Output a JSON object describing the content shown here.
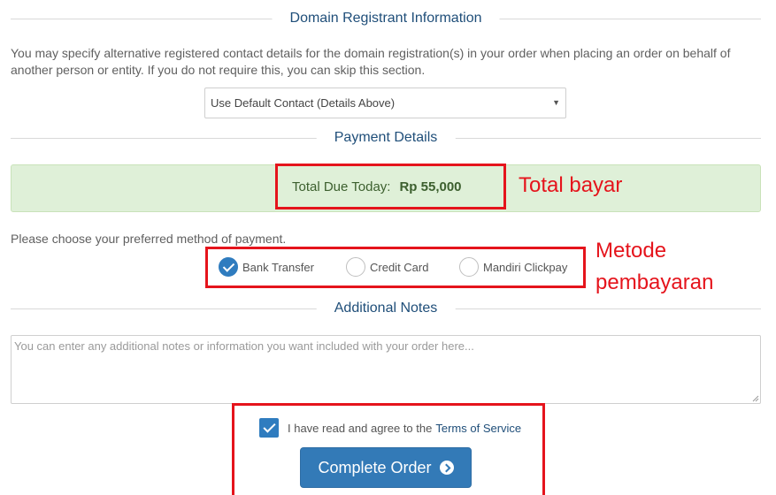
{
  "domain_registrant": {
    "title": "Domain Registrant Information",
    "description": "You may specify alternative registered contact details for the domain registration(s) in your order when placing an order on behalf of another person or entity. If you do not require this, you can skip this section.",
    "contact_select": "Use Default Contact (Details Above)"
  },
  "payment": {
    "title": "Payment Details",
    "total_label": "Total Due Today:",
    "total_amount": "Rp 55,000",
    "choose_text": "Please choose your preferred method of payment.",
    "methods": [
      {
        "label": "Bank Transfer",
        "selected": true
      },
      {
        "label": "Credit Card",
        "selected": false
      },
      {
        "label": "Mandiri Clickpay",
        "selected": false
      }
    ]
  },
  "notes": {
    "title": "Additional Notes",
    "placeholder": "You can enter any additional notes or information you want included with your order here..."
  },
  "agreement": {
    "text": "I have read and agree to the",
    "link": "Terms of Service",
    "checked": true
  },
  "submit": {
    "label": "Complete Order"
  },
  "annotations": {
    "total": "Total bayar",
    "method_line1": "Metode",
    "method_line2": "pembayaran"
  },
  "colors": {
    "annotation": "#e5141c",
    "accent": "#337ab7",
    "success_bg": "#dff0d8"
  }
}
